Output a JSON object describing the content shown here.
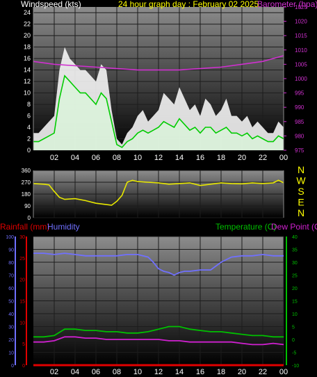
{
  "title": "24 hour graph day : February 02 2025",
  "colors": {
    "background": "#000000",
    "wind_text": "#ffffff",
    "wind_fill": "#ffffff",
    "gust_fill": "#d8ffd8",
    "wind_avg": "#00cc00",
    "barometer": "#d030d0",
    "direction": "#e8e800",
    "rainfall": "#e00000",
    "humidity": "#7070ff",
    "temperature": "#00c000",
    "dewpoint": "#d020d0",
    "title": "#ffff00",
    "grid": "#1c1c1c",
    "frame": "#8a8a8a"
  },
  "chart_data": [
    {
      "id": "wind",
      "type": "area",
      "title": "24 hour graph day : February 02 2025",
      "ylabel_left": "Windspeed (kts)",
      "ylabel_right": "Barometer (hpa)",
      "x_ticks": [
        "02",
        "04",
        "06",
        "08",
        "10",
        "12",
        "14",
        "16",
        "18",
        "20",
        "22",
        "00"
      ],
      "ylim_left": [
        0,
        25
      ],
      "ylim_right": [
        975,
        1025
      ],
      "y_ticks_left": [
        "0",
        "2",
        "4",
        "6",
        "8",
        "10",
        "12",
        "14",
        "16",
        "18",
        "20",
        "22",
        "24"
      ],
      "y_ticks_right": [
        "975",
        "980",
        "985",
        "990",
        "995",
        "1000",
        "1005",
        "1010",
        "1015",
        "1020",
        "1025"
      ],
      "series": [
        {
          "name": "Windspeed (kts)",
          "role": "gust",
          "x": [
            0,
            0.5,
            1,
            1.5,
            2,
            2.5,
            3,
            3.5,
            4,
            4.5,
            5,
            5.5,
            6,
            6.5,
            7,
            7.5,
            8,
            8.5,
            9,
            9.5,
            10,
            10.5,
            11,
            11.5,
            12,
            12.5,
            13,
            13.5,
            14,
            14.5,
            15,
            15.5,
            16,
            16.5,
            17,
            17.5,
            18,
            18.5,
            19,
            19.5,
            20,
            20.5,
            21,
            21.5,
            22,
            22.5,
            23,
            23.5,
            24
          ],
          "values": [
            3,
            3,
            4,
            5,
            6,
            14,
            18,
            16,
            15,
            14,
            14,
            13,
            12,
            15,
            14,
            7,
            2,
            1,
            3,
            4,
            6,
            7,
            5,
            6,
            7,
            10,
            9,
            8,
            11,
            9,
            7,
            8,
            6,
            9,
            8,
            6,
            7,
            9,
            6,
            6,
            5,
            6,
            4,
            5,
            4,
            3,
            3,
            5,
            4
          ]
        },
        {
          "name": "Average",
          "role": "average",
          "x": [
            0,
            0.5,
            1,
            1.5,
            2,
            2.5,
            3,
            3.5,
            4,
            4.5,
            5,
            5.5,
            6,
            6.5,
            7,
            7.5,
            8,
            8.5,
            9,
            9.5,
            10,
            10.5,
            11,
            11.5,
            12,
            12.5,
            13,
            13.5,
            14,
            14.5,
            15,
            15.5,
            16,
            16.5,
            17,
            17.5,
            18,
            18.5,
            19,
            19.5,
            20,
            20.5,
            21,
            21.5,
            22,
            22.5,
            23,
            23.5,
            24
          ],
          "values": [
            1.5,
            1.5,
            2,
            2.5,
            3,
            9,
            13,
            12,
            11,
            10,
            10,
            9,
            8,
            10,
            9,
            5,
            1,
            0.5,
            1.5,
            2,
            3,
            3.5,
            3,
            3.5,
            4,
            5,
            4.5,
            4,
            5.5,
            4.5,
            3.5,
            4,
            3,
            4,
            4,
            3,
            3.5,
            4,
            3,
            3,
            2.5,
            3,
            2,
            2.5,
            2,
            1.5,
            1.5,
            2.5,
            2
          ]
        },
        {
          "name": "Barometer (hpa)",
          "role": "barometer",
          "x": [
            0,
            2,
            4,
            6,
            8,
            10,
            12,
            14,
            16,
            18,
            20,
            22,
            24
          ],
          "values": [
            1006,
            1005,
            1004.5,
            1004,
            1003.5,
            1003,
            1003,
            1003,
            1003.5,
            1004,
            1005,
            1006,
            1008
          ]
        }
      ]
    },
    {
      "id": "direction",
      "type": "line",
      "ylim": [
        0,
        360
      ],
      "y_ticks": [
        "0",
        "90",
        "180",
        "270",
        "360"
      ],
      "compass": [
        "N",
        "W",
        "S",
        "E",
        "N"
      ],
      "series": [
        {
          "name": "Direction",
          "x": [
            0,
            1,
            1.5,
            2,
            2.5,
            3,
            4,
            5,
            6,
            7,
            7.5,
            8,
            8.5,
            9,
            9.5,
            10,
            11,
            12,
            13,
            14,
            15,
            16,
            17,
            18,
            19,
            20,
            21,
            22,
            23,
            23.5,
            24
          ],
          "values": [
            260,
            255,
            250,
            200,
            155,
            140,
            145,
            130,
            110,
            100,
            95,
            125,
            170,
            270,
            285,
            275,
            270,
            265,
            255,
            260,
            265,
            245,
            255,
            265,
            260,
            258,
            265,
            260,
            265,
            285,
            265
          ]
        }
      ]
    },
    {
      "id": "climate",
      "type": "line",
      "labels": {
        "rainfall": "Rainfall (mm)",
        "humidity": "Humidity",
        "temperature": "Temperature (C)",
        "dewpoint": "Dew Point (C)"
      },
      "x_ticks": [
        "02",
        "04",
        "06",
        "08",
        "10",
        "12",
        "14",
        "16",
        "18",
        "20",
        "22",
        "00"
      ],
      "humidity_axis": {
        "ylim": [
          0,
          100
        ],
        "ticks": [
          "0",
          "10",
          "20",
          "30",
          "40",
          "50",
          "60",
          "70",
          "80",
          "90",
          "100"
        ]
      },
      "rain_axis": {
        "ylim": [
          0,
          30
        ],
        "ticks": [
          "0",
          "5",
          "10",
          "15",
          "20",
          "25",
          "30"
        ]
      },
      "temp_axis": {
        "ylim": [
          -10,
          40
        ],
        "ticks": [
          "-10",
          "-5",
          "0",
          "5",
          "10",
          "15",
          "20",
          "25",
          "30",
          "35",
          "40"
        ]
      },
      "series": [
        {
          "name": "Humidity",
          "axis": "humidity",
          "x": [
            0,
            1,
            2,
            3,
            4,
            5,
            6,
            7,
            8,
            9,
            10,
            10.5,
            11,
            11.5,
            12,
            12.5,
            13,
            13.5,
            14,
            14.5,
            15,
            16,
            17,
            18,
            19,
            20,
            21,
            22,
            23,
            24
          ],
          "values": [
            87,
            87,
            86,
            87,
            86,
            85,
            85,
            85,
            85,
            86,
            86,
            85,
            84,
            80,
            75,
            73,
            72,
            70,
            72,
            73,
            73,
            74,
            74,
            80,
            84,
            85,
            85,
            86,
            85,
            85
          ]
        },
        {
          "name": "Temperature (C)",
          "axis": "temp",
          "x": [
            0,
            1,
            2,
            3,
            4,
            5,
            6,
            7,
            8,
            9,
            10,
            11,
            12,
            13,
            14,
            15,
            16,
            17,
            18,
            19,
            20,
            21,
            22,
            23,
            24
          ],
          "values": [
            1,
            1,
            1.5,
            4,
            4,
            3.5,
            3.5,
            3,
            3,
            2.5,
            2.5,
            3,
            4,
            5,
            5,
            4,
            3.5,
            3,
            3,
            2.5,
            2,
            1.5,
            1.5,
            1,
            1
          ]
        },
        {
          "name": "Dew Point (C)",
          "axis": "temp",
          "x": [
            0,
            1,
            2,
            3,
            4,
            5,
            6,
            7,
            8,
            9,
            10,
            11,
            12,
            13,
            14,
            15,
            16,
            17,
            18,
            19,
            20,
            21,
            22,
            23,
            24
          ],
          "values": [
            -1,
            -1,
            -0.5,
            1,
            1,
            0.5,
            0.5,
            0,
            0,
            0,
            0,
            0,
            0,
            -0.5,
            -0.5,
            -1,
            -1,
            -1,
            -1,
            -1,
            -1.5,
            -2,
            -2,
            -1.5,
            -2
          ]
        },
        {
          "name": "Rainfall (mm)",
          "axis": "rain",
          "x": [
            0,
            24
          ],
          "values": [
            0,
            0
          ]
        }
      ]
    }
  ]
}
